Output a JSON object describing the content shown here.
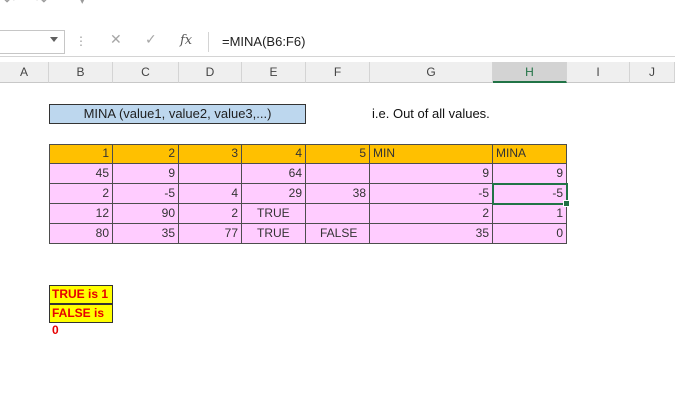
{
  "formula_bar": {
    "formula": "=MINA(B6:F6)",
    "fx_label": "fx"
  },
  "columns": [
    "A",
    "B",
    "C",
    "D",
    "E",
    "F",
    "G",
    "H",
    "I",
    "J"
  ],
  "selected_column": "H",
  "title_box": "MINA (value1, value2, value3,...)",
  "note": "i.e. Out of all values.",
  "table": {
    "header": [
      "1",
      "2",
      "3",
      "4",
      "5",
      "MIN",
      "MINA"
    ],
    "rows": [
      [
        "45",
        "9",
        "",
        "64",
        "",
        "9",
        "9"
      ],
      [
        "2",
        "-5",
        "4",
        "29",
        "38",
        "-5",
        "-5"
      ],
      [
        "12",
        "90",
        "2",
        "TRUE",
        "",
        "2",
        "1"
      ],
      [
        "80",
        "35",
        "77",
        "TRUE",
        "FALSE",
        "35",
        "0"
      ]
    ]
  },
  "legend": {
    "true_note": "TRUE is 1",
    "false_note": "FALSE is 0"
  },
  "colors": {
    "header_fill": "#ffc000",
    "body_fill": "#ffccff",
    "title_fill": "#bdd7ee",
    "legend_fill": "#ffff00",
    "legend_text": "#e60000",
    "selection": "#217346"
  }
}
